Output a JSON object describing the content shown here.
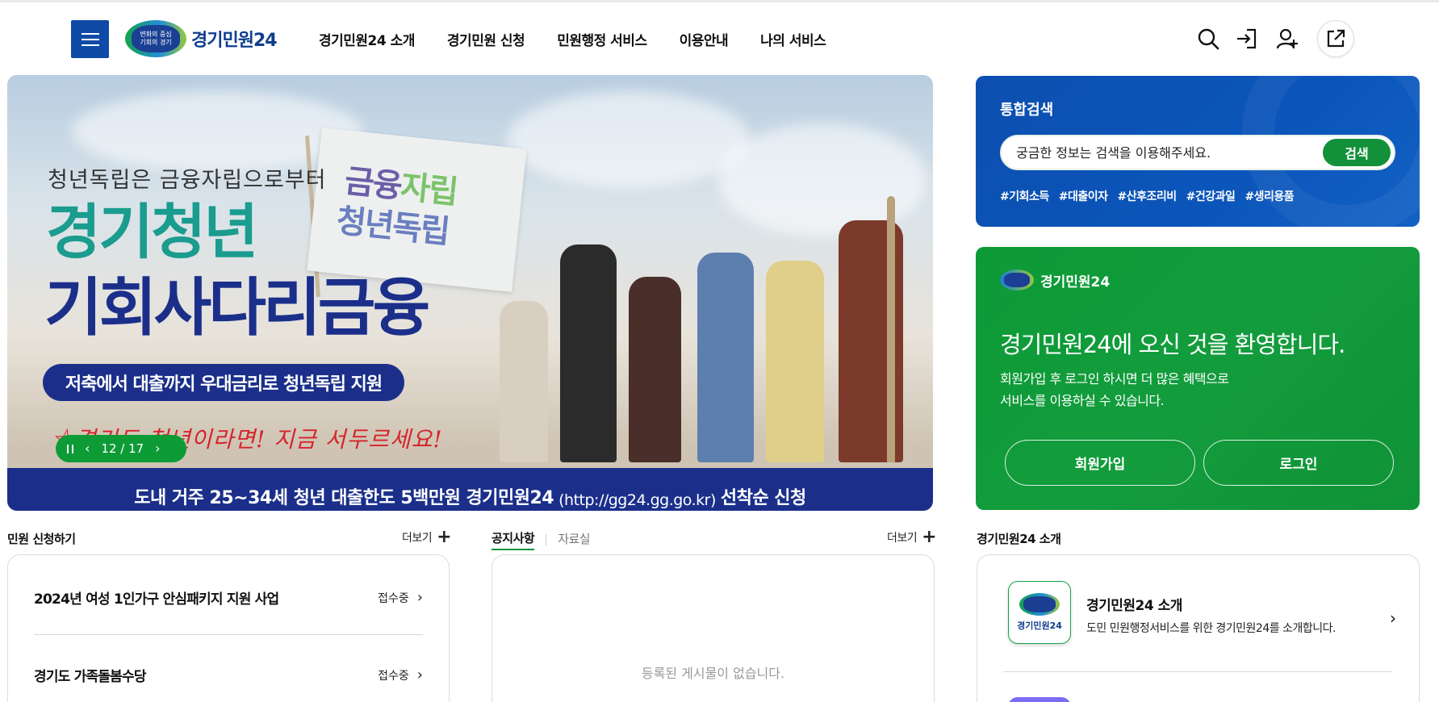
{
  "header": {
    "logo_text": "경기민원24",
    "logo_badge_line1": "변화의 중심",
    "logo_badge_line2": "기회의 경기",
    "nav": [
      "경기민원24 소개",
      "경기민원 신청",
      "민원행정 서비스",
      "이용안내",
      "나의 서비스"
    ]
  },
  "banner": {
    "tagline": "청년독립은 금융자립으로부터",
    "title_line1": "경기청년",
    "title_line2": "기회사다리금융",
    "pill": "저축에서 대출까지 우대금리로 청년독립 지원",
    "script": "☆경기도 청년이라면! 지금 서두르세요!",
    "flag_line1a": "금융",
    "flag_line1b": "자립",
    "flag_line2": "청년독립",
    "bottom_pre": "도내 거주 25~34세 청년 대출한도 5백만원 경기민원24",
    "bottom_url": "(http://gg24.gg.go.kr)",
    "bottom_post": "선착순 신청",
    "counter": "12 / 17"
  },
  "search": {
    "title": "통합검색",
    "placeholder": "궁금한 정보는 검색을 이용해주세요.",
    "button": "검색",
    "tags": [
      "#기회소득",
      "#대출이자",
      "#산후조리비",
      "#건강과일",
      "#생리용품"
    ]
  },
  "welcome": {
    "brand": "경기민원24",
    "headline": "경기민원24에 오신 것을 환영합니다.",
    "desc_line1": "회원가입 후 로그인 하시면 더 많은 혜택으로",
    "desc_line2": "서비스를 이용하실 수 있습니다.",
    "signup": "회원가입",
    "login": "로그인"
  },
  "apply": {
    "title": "민원 신청하기",
    "more": "더보기",
    "items": [
      {
        "title": "2024년 여성 1인가구 안심패키지 지원 사업",
        "status": "접수중"
      },
      {
        "title": "경기도 가족돌봄수당",
        "status": "접수중"
      }
    ]
  },
  "notice": {
    "tab_active": "공지사항",
    "tab_other": "자료실",
    "more": "더보기",
    "empty": "등록된 게시물이 없습니다."
  },
  "intro": {
    "title": "경기민원24 소개",
    "item_title": "경기민원24 소개",
    "item_desc": "도민 민원행정서비스를 위한 경기민원24를 소개합니다.",
    "logo_label": "경기민원24"
  },
  "colors": {
    "brand_blue": "#0f4aa7",
    "brand_green": "#12913a",
    "banner_navy": "#1b2f8a"
  }
}
